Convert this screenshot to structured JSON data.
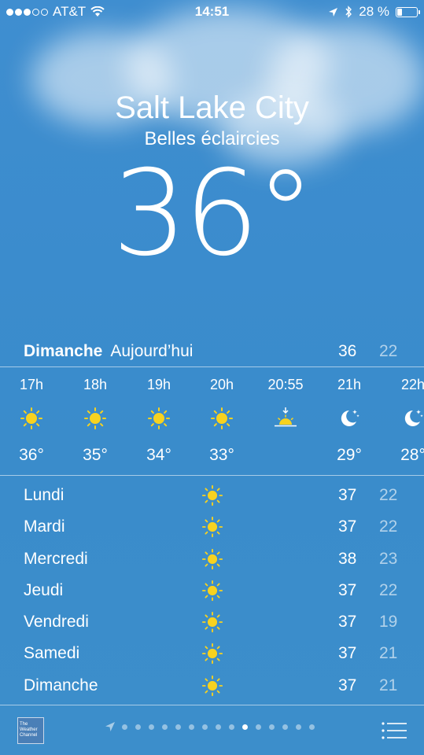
{
  "status_bar": {
    "carrier": "AT&T",
    "signal_filled": 3,
    "signal_total": 5,
    "time": "14:51",
    "battery_percent": "28 %",
    "battery_level": 0.28
  },
  "weather": {
    "city": "Salt Lake City",
    "condition": "Belles éclaircies",
    "temperature": "36°"
  },
  "today": {
    "day": "Dimanche",
    "label": "Aujourd’hui",
    "high": "36",
    "low": "22"
  },
  "hourly": [
    {
      "time": "17h",
      "icon": "sun-icon",
      "temp": "36°"
    },
    {
      "time": "18h",
      "icon": "sun-icon",
      "temp": "35°"
    },
    {
      "time": "19h",
      "icon": "sun-icon",
      "temp": "34°"
    },
    {
      "time": "20h",
      "icon": "sun-icon",
      "temp": "33°"
    },
    {
      "time": "20:55",
      "icon": "sunset-icon",
      "temp": ""
    },
    {
      "time": "21h",
      "icon": "moon-icon",
      "temp": "29°"
    },
    {
      "time": "22h",
      "icon": "moon-icon",
      "temp": "28°"
    }
  ],
  "daily": [
    {
      "day": "Lundi",
      "icon": "sun-icon",
      "high": "37",
      "low": "22"
    },
    {
      "day": "Mardi",
      "icon": "sun-icon",
      "high": "37",
      "low": "22"
    },
    {
      "day": "Mercredi",
      "icon": "sun-icon",
      "high": "38",
      "low": "23"
    },
    {
      "day": "Jeudi",
      "icon": "sun-icon",
      "high": "37",
      "low": "22"
    },
    {
      "day": "Vendredi",
      "icon": "sun-icon",
      "high": "37",
      "low": "19"
    },
    {
      "day": "Samedi",
      "icon": "sun-icon",
      "high": "37",
      "low": "21"
    },
    {
      "day": "Dimanche",
      "icon": "sun-icon",
      "high": "37",
      "low": "21"
    }
  ],
  "bottom_bar": {
    "logo_text": "The Weather Channel",
    "page_count": 15,
    "active_page": 9
  },
  "colors": {
    "sun": "#f7d21f",
    "sky": "#3a8ccb"
  }
}
